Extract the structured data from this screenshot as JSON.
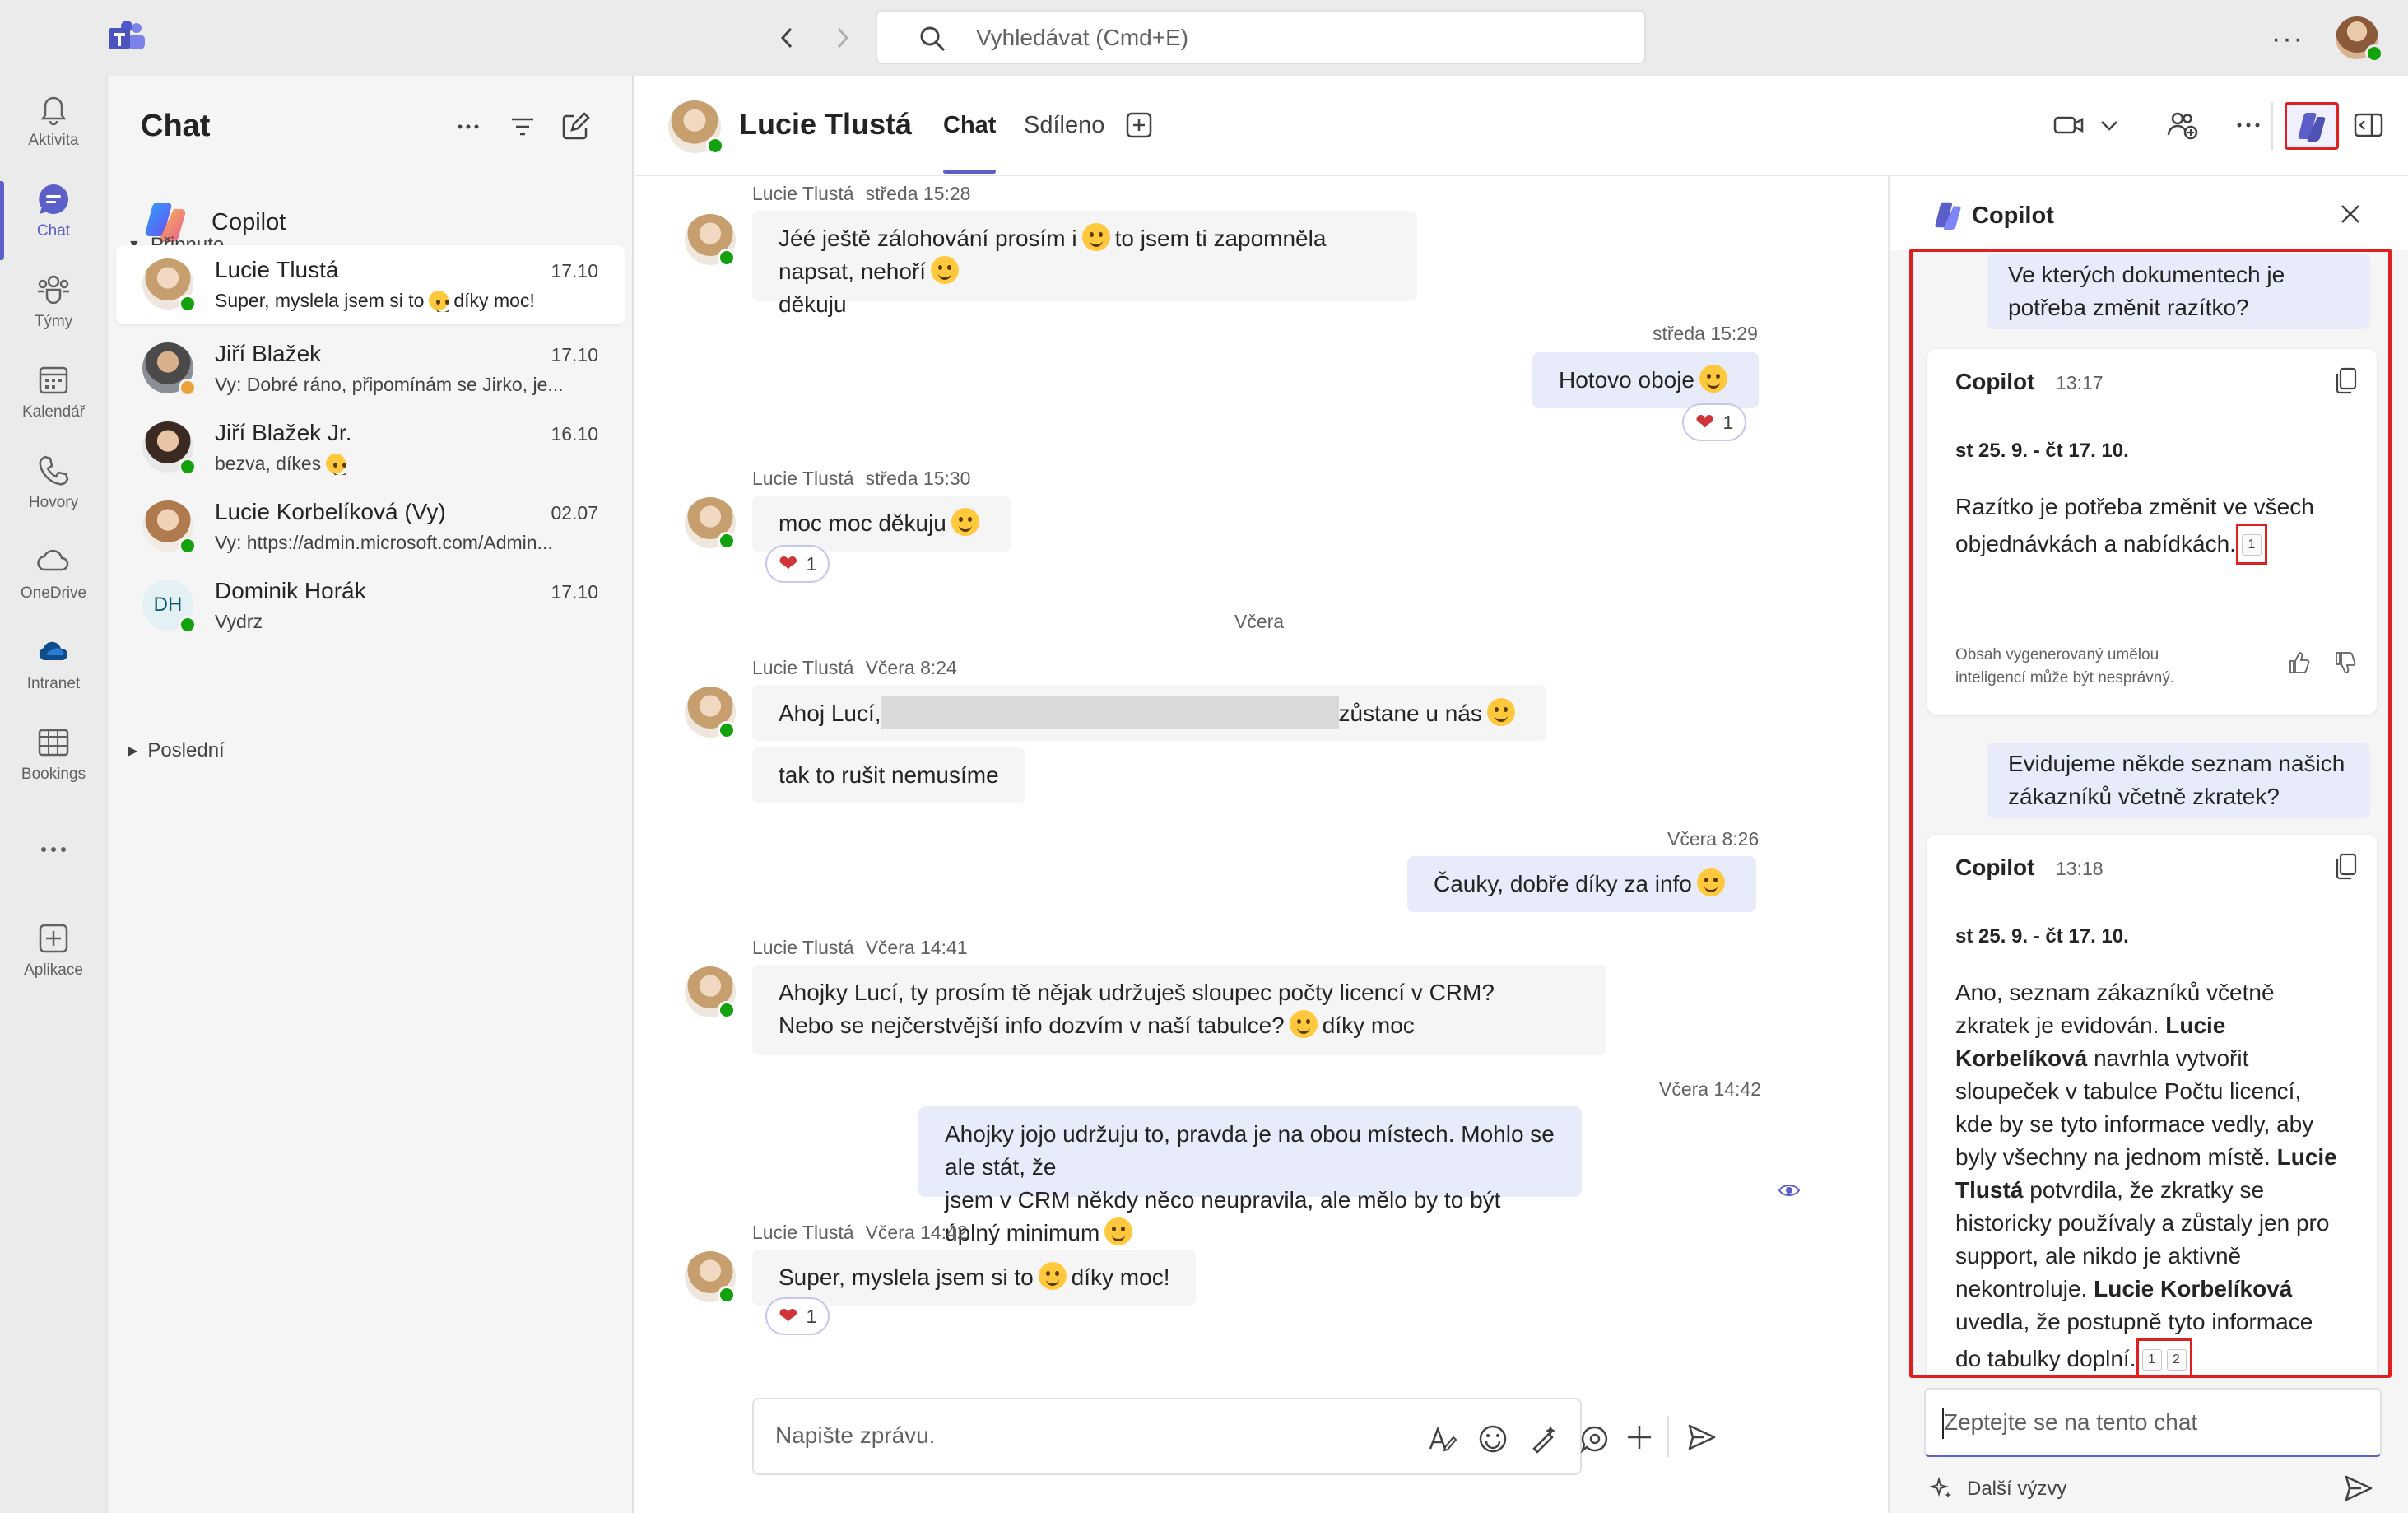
{
  "topbar": {
    "search_placeholder": "Vyhledávat (Cmd+E)"
  },
  "rail": {
    "items": [
      {
        "label": "Aktivita",
        "icon": "bell-icon"
      },
      {
        "label": "Chat",
        "icon": "chat-icon"
      },
      {
        "label": "Týmy",
        "icon": "teams-icon"
      },
      {
        "label": "Kalendář",
        "icon": "calendar-icon"
      },
      {
        "label": "Hovory",
        "icon": "phone-icon"
      },
      {
        "label": "OneDrive",
        "icon": "cloud-icon"
      },
      {
        "label": "Intranet",
        "icon": "sharepoint-cloud-icon"
      },
      {
        "label": "Bookings",
        "icon": "bookings-icon"
      },
      {
        "label": "Aplikace",
        "icon": "add-apps-icon"
      }
    ]
  },
  "chatlist": {
    "title": "Chat",
    "copilot_label": "Copilot",
    "pinned_label": "Připnuto",
    "recent_label": "Poslední",
    "conversations": [
      {
        "name": "Lucie Tlustá",
        "date": "17.10",
        "preview_before": "Super, myslela jsem si to",
        "preview_after": "díky moc!"
      },
      {
        "name": "Jiří Blažek",
        "date": "17.10",
        "preview": "Vy: Dobré ráno, připomínám se Jirko, je..."
      },
      {
        "name": "Jiří Blažek Jr.",
        "date": "16.10",
        "preview": "bezva, díkes"
      },
      {
        "name": "Lucie Korbelíková (Vy)",
        "date": "02.07",
        "preview": "Vy: https://admin.microsoft.com/Admin..."
      },
      {
        "name": "Dominik Horák",
        "date": "17.10",
        "preview": "Vydrz",
        "initials": "DH"
      }
    ]
  },
  "conversation": {
    "name": "Lucie Tlustá",
    "tabs": [
      "Chat",
      "Sdíleno"
    ],
    "day_separator": "Včera",
    "composer_placeholder": "Napište zprávu.",
    "messages": [
      {
        "sender": "Lucie Tlustá",
        "time": "středa 15:28",
        "line1_a": "Jéé ještě zálohování prosím i",
        "line1_b": "to jsem ti zapomněla napsat, nehoří",
        "line2": "děkuju"
      },
      {
        "time": "středa 15:29",
        "text": "Hotovo oboje",
        "reaction_count": "1"
      },
      {
        "sender": "Lucie Tlustá",
        "time": "středa 15:30",
        "text": "moc moc děkuju",
        "reaction_count": "1"
      },
      {
        "sender": "Lucie Tlustá",
        "time": "Včera 8:24",
        "text_a": "Ahoj Lucí,",
        "text_b": "zůstane u nás"
      },
      {
        "text": "tak to rušit nemusíme"
      },
      {
        "time": "Včera 8:26",
        "text": "Čauky, dobře díky za info"
      },
      {
        "sender": "Lucie Tlustá",
        "time": "Včera 14:41",
        "line1": "Ahojky Lucí, ty prosím tě nějak udržuješ sloupec počty licencí v CRM?",
        "line2_a": "Nebo se nejčerstvější info dozvím v naší tabulce?",
        "line2_b": "díky moc"
      },
      {
        "time": "Včera 14:42",
        "line1": "Ahojky jojo udržuju to, pravda je na obou místech. Mohlo se ale stát, že",
        "line2": "jsem v CRM někdy něco neupravila, ale mělo by to být úplný minimum"
      },
      {
        "sender": "Lucie Tlustá",
        "time": "Včera 14:42",
        "text_a": "Super, myslela jsem si to",
        "text_b": "díky moc!",
        "reaction_count": "1"
      }
    ]
  },
  "copilot": {
    "title": "Copilot",
    "q1_line1": "Ve kterých dokumentech je",
    "q1_line2": "potřeba změnit razítko?",
    "a1": {
      "who": "Copilot",
      "time": "13:17",
      "date": "st 25. 9. - čt 17. 10.",
      "line1": "Razítko je potřeba změnit ve všech",
      "line2": "objednávkách a nabídkách.",
      "cite": "1",
      "disclaimer_line1": "Obsah vygenerovaný umělou",
      "disclaimer_line2": "inteligencí může být nesprávný."
    },
    "q2_line1": "Evidujeme někde seznam našich",
    "q2_line2": "zákazníků včetně zkratek?",
    "a2": {
      "who": "Copilot",
      "time": "13:18",
      "date": "st 25. 9. - čt 17. 10.",
      "l1": "Ano, seznam zákazníků včetně",
      "l2a": "zkratek je evidován.",
      "l2b": "Lucie",
      "l3a": "Korbelíková",
      "l3b": "navrhla vytvořit",
      "l4": "sloupeček v tabulce Počtu licencí,",
      "l5": "kde by se tyto informace vedly, aby",
      "l6a": "byly všechny na jednom místě.",
      "l6b": "Lucie",
      "l7a": "Tlustá",
      "l7b": "potvrdila, že zkratky se",
      "l8": "historicky používaly a zůstaly jen pro",
      "l9": "support, ale nikdo je aktivně",
      "l10a": "nekontroluje.",
      "l10b": "Lucie Korbelíková",
      "l11": "uvedla, že postupně tyto informace",
      "l12": "do tabulky doplní.",
      "cite1": "1",
      "cite2": "2"
    },
    "input_placeholder": "Zeptejte se na tento chat",
    "more_prompts": "Další výzvy"
  },
  "colors": {
    "accent": "#5b5fc7",
    "highlight_border": "#e02020",
    "presence_available": "#13a10e",
    "presence_away": "#e9a33a",
    "reaction_heart": "#d13438"
  }
}
